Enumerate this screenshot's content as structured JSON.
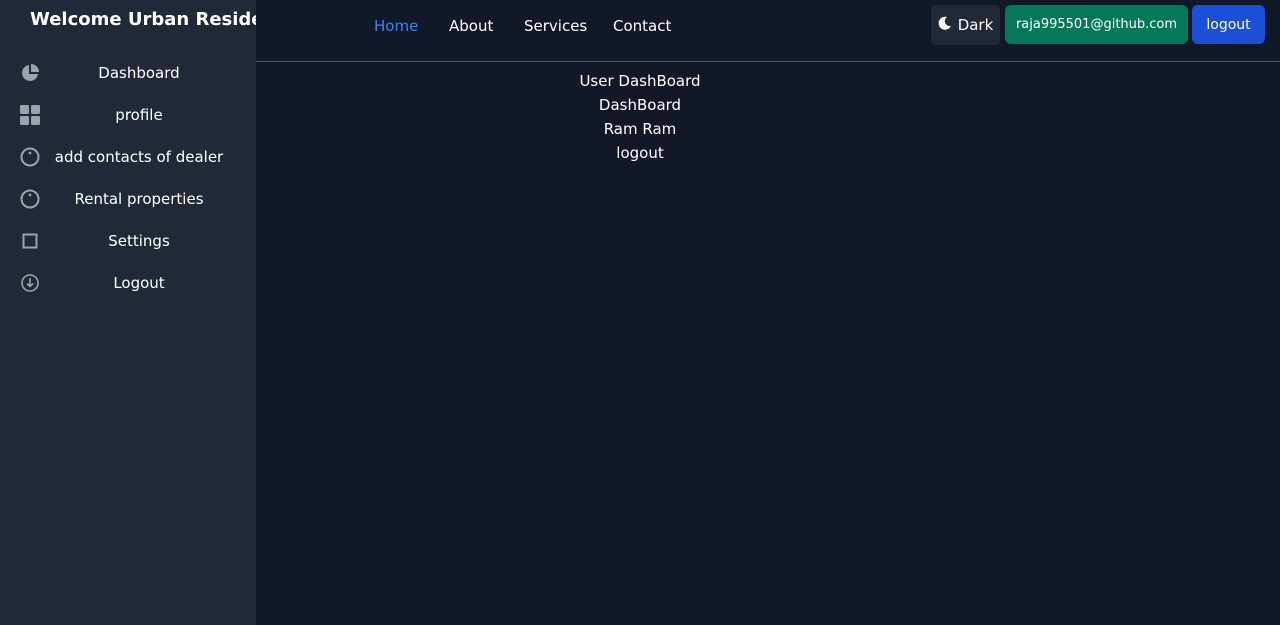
{
  "sidebar": {
    "brand": "Welcome Urban Resident",
    "items": [
      {
        "label": "Dashboard",
        "icon": "pie-chart-icon"
      },
      {
        "label": "profile",
        "icon": "grid-icon"
      },
      {
        "label": "add contacts of dealer",
        "icon": "circle-icon"
      },
      {
        "label": "Rental properties",
        "icon": "circle-icon"
      },
      {
        "label": "Settings",
        "icon": "square-icon"
      },
      {
        "label": "Logout",
        "icon": "download-circle-icon"
      }
    ]
  },
  "nav": {
    "links": [
      "Home",
      "About",
      "Services",
      "Contact"
    ],
    "active": "Home"
  },
  "header": {
    "theme_label": "Dark",
    "email": "raja995501@github.com",
    "logout_label": "logout"
  },
  "main": {
    "lines": [
      "User DashBoard",
      "DashBoard",
      "Ram Ram",
      "logout"
    ]
  },
  "colors": {
    "background": "#111827",
    "sidebar": "#1f2937",
    "active_link": "#3b82f6",
    "email_button": "#047857",
    "logout_button": "#1d4ed8"
  }
}
